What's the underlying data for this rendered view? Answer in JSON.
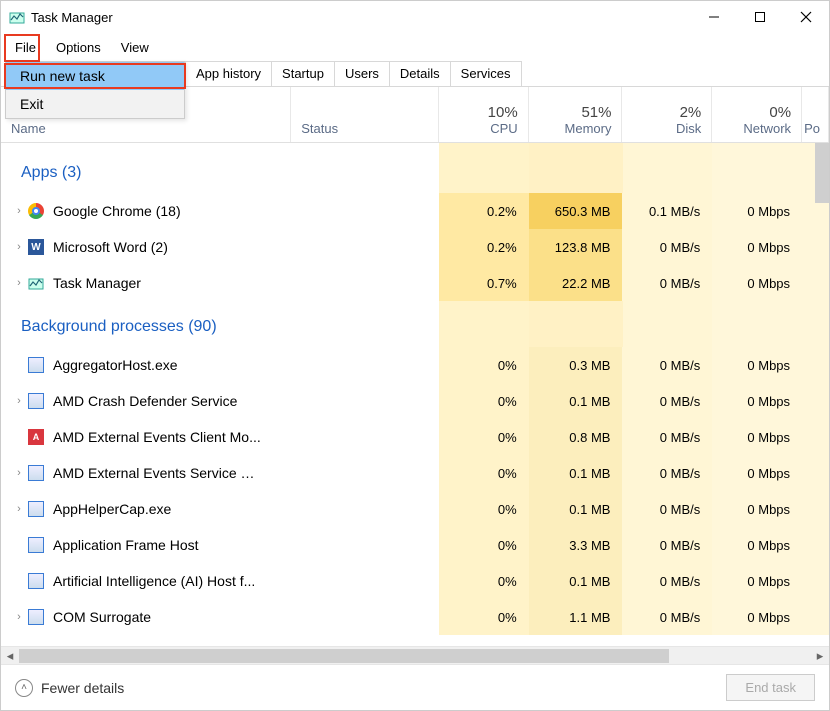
{
  "window": {
    "title": "Task Manager"
  },
  "menubar": {
    "file": "File",
    "options": "Options",
    "view": "View"
  },
  "file_menu": {
    "run_new_task": "Run new task",
    "exit": "Exit"
  },
  "tabs": {
    "app_history": "App history",
    "startup": "Startup",
    "users": "Users",
    "details": "Details",
    "services": "Services"
  },
  "columns": {
    "name": "Name",
    "status": "Status",
    "cpu": {
      "pct": "10%",
      "label": "CPU"
    },
    "memory": {
      "pct": "51%",
      "label": "Memory"
    },
    "disk": {
      "pct": "2%",
      "label": "Disk"
    },
    "network": {
      "pct": "0%",
      "label": "Network"
    },
    "power_partial": "Po"
  },
  "groups": {
    "apps": {
      "label": "Apps (3)"
    },
    "background": {
      "label": "Background processes (90)"
    }
  },
  "apps": [
    {
      "name": "Google Chrome (18)",
      "icon": "chrome",
      "expandable": true,
      "cpu": "0.2%",
      "memory": "650.3 MB",
      "disk": "0.1 MB/s",
      "network": "0 Mbps",
      "heavy": true
    },
    {
      "name": "Microsoft Word (2)",
      "icon": "word",
      "expandable": true,
      "cpu": "0.2%",
      "memory": "123.8 MB",
      "disk": "0 MB/s",
      "network": "0 Mbps"
    },
    {
      "name": "Task Manager",
      "icon": "tm",
      "expandable": true,
      "cpu": "0.7%",
      "memory": "22.2 MB",
      "disk": "0 MB/s",
      "network": "0 Mbps"
    }
  ],
  "bg": [
    {
      "name": "AggregatorHost.exe",
      "icon": "generic",
      "expandable": false,
      "cpu": "0%",
      "memory": "0.3 MB",
      "disk": "0 MB/s",
      "network": "0 Mbps"
    },
    {
      "name": "AMD Crash Defender Service",
      "icon": "generic",
      "expandable": true,
      "cpu": "0%",
      "memory": "0.1 MB",
      "disk": "0 MB/s",
      "network": "0 Mbps"
    },
    {
      "name": "AMD External Events Client Mo...",
      "icon": "amd",
      "expandable": false,
      "cpu": "0%",
      "memory": "0.8 MB",
      "disk": "0 MB/s",
      "network": "0 Mbps"
    },
    {
      "name": "AMD External Events Service M...",
      "icon": "generic",
      "expandable": true,
      "cpu": "0%",
      "memory": "0.1 MB",
      "disk": "0 MB/s",
      "network": "0 Mbps"
    },
    {
      "name": "AppHelperCap.exe",
      "icon": "generic",
      "expandable": true,
      "cpu": "0%",
      "memory": "0.1 MB",
      "disk": "0 MB/s",
      "network": "0 Mbps"
    },
    {
      "name": "Application Frame Host",
      "icon": "generic",
      "expandable": false,
      "cpu": "0%",
      "memory": "3.3 MB",
      "disk": "0 MB/s",
      "network": "0 Mbps"
    },
    {
      "name": "Artificial Intelligence (AI) Host f...",
      "icon": "generic",
      "expandable": false,
      "cpu": "0%",
      "memory": "0.1 MB",
      "disk": "0 MB/s",
      "network": "0 Mbps"
    },
    {
      "name": "COM Surrogate",
      "icon": "generic",
      "expandable": true,
      "cpu": "0%",
      "memory": "1.1 MB",
      "disk": "0 MB/s",
      "network": "0 Mbps"
    }
  ],
  "footer": {
    "fewer_details": "Fewer details",
    "end_task": "End task"
  }
}
